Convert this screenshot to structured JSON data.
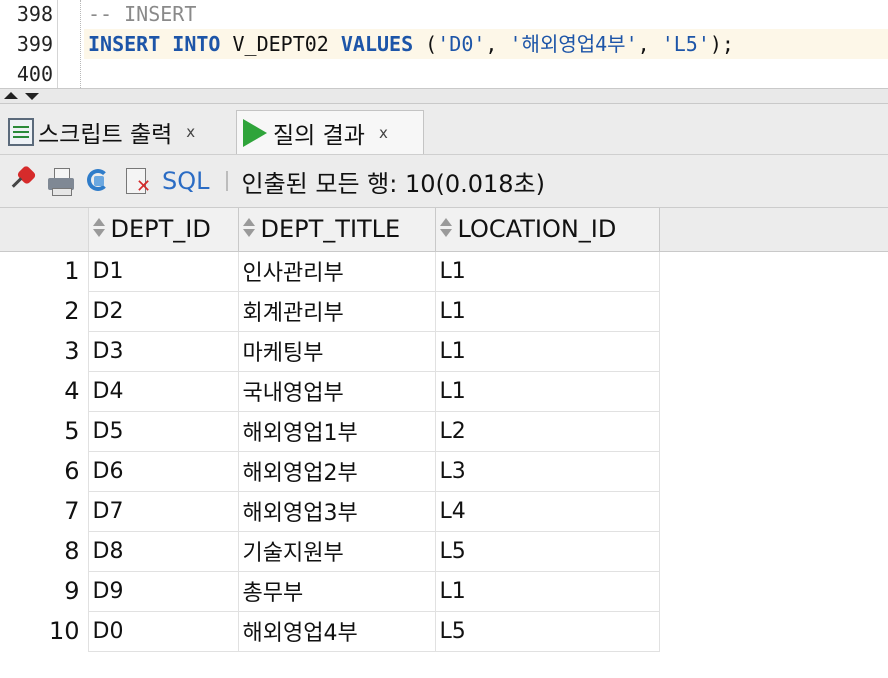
{
  "editor": {
    "line_numbers": [
      "398",
      "399",
      "400"
    ],
    "comment_line": "-- INSERT",
    "code": {
      "kw1": "INSERT",
      "kw2": "INTO",
      "table": "V_DEPT02",
      "kw3": "VALUES",
      "open": " (",
      "v1": "'D0'",
      "sep1": ", ",
      "v2": "'해외영업4부'",
      "sep2": ", ",
      "v3": "'L5'",
      "close": ");"
    }
  },
  "tabs": [
    {
      "label": "스크립트 출력",
      "close": "x",
      "icon": "script-output-icon"
    },
    {
      "label": "질의 결과",
      "close": "x",
      "icon": "run-query-icon"
    }
  ],
  "toolbar": {
    "sql_label": "SQL",
    "status": "인출된 모든 행: 10(0.018초)",
    "icons": [
      "pin-icon",
      "print-icon",
      "refresh-icon",
      "delete-document-icon"
    ]
  },
  "grid": {
    "columns": [
      "DEPT_ID",
      "DEPT_TITLE",
      "LOCATION_ID"
    ],
    "rows": [
      {
        "num": "1",
        "dept_id": "D1",
        "dept_title": "인사관리부",
        "location_id": "L1"
      },
      {
        "num": "2",
        "dept_id": "D2",
        "dept_title": "회계관리부",
        "location_id": "L1"
      },
      {
        "num": "3",
        "dept_id": "D3",
        "dept_title": "마케팅부",
        "location_id": "L1"
      },
      {
        "num": "4",
        "dept_id": "D4",
        "dept_title": "국내영업부",
        "location_id": "L1"
      },
      {
        "num": "5",
        "dept_id": "D5",
        "dept_title": "해외영업1부",
        "location_id": "L2"
      },
      {
        "num": "6",
        "dept_id": "D6",
        "dept_title": "해외영업2부",
        "location_id": "L3"
      },
      {
        "num": "7",
        "dept_id": "D7",
        "dept_title": "해외영업3부",
        "location_id": "L4"
      },
      {
        "num": "8",
        "dept_id": "D8",
        "dept_title": "기술지원부",
        "location_id": "L5"
      },
      {
        "num": "9",
        "dept_id": "D9",
        "dept_title": "총무부",
        "location_id": "L1"
      },
      {
        "num": "10",
        "dept_id": "D0",
        "dept_title": "해외영업4부",
        "location_id": "L5"
      }
    ]
  },
  "colors": {
    "keyword": "#1d55a8",
    "comment": "#8a8a8a",
    "run_icon": "#2fa43a",
    "sql_link": "#2b6cc4"
  }
}
